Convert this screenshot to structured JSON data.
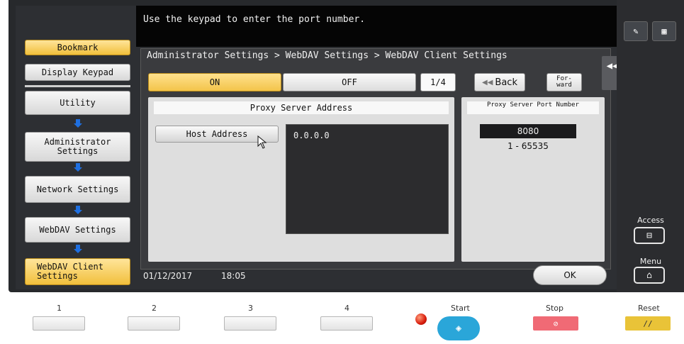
{
  "message": "Use the keypad to enter the port number.",
  "nav": {
    "bookmark": "Bookmark",
    "display_keypad": "Display Keypad",
    "utility": "Utility",
    "administrator_settings": "Administrator Settings",
    "network_settings": "Network Settings",
    "webdav_settings": "WebDAV Settings",
    "webdav_client_settings": "WebDAV Client Settings"
  },
  "breadcrumb": "Administrator Settings > WebDAV Settings > WebDAV Client Settings",
  "toggle": {
    "on": "ON",
    "off": "OFF"
  },
  "page_indicator": "1/4",
  "back_label": "Back",
  "forward_label": "For- ward",
  "proxy": {
    "header": "Proxy Server Address",
    "host_button": "Host Address",
    "host_value": "0.0.0.0"
  },
  "port": {
    "header": "Proxy Server Port Number",
    "value": "8080",
    "range": "1 - 65535"
  },
  "footer": {
    "date": "01/12/2017",
    "time": "18:05",
    "ok": "OK"
  },
  "side": {
    "access": "Access",
    "menu": "Menu"
  },
  "keys": {
    "k1": "1",
    "k2": "2",
    "k3": "3",
    "k4": "4",
    "start": "Start",
    "stop": "Stop",
    "reset": "Reset"
  },
  "colors": {
    "accent_yellow": "#f3c44a",
    "start_blue": "#2aa6d9",
    "stop_red": "#f06a75",
    "reset_yellow": "#e9c338"
  }
}
